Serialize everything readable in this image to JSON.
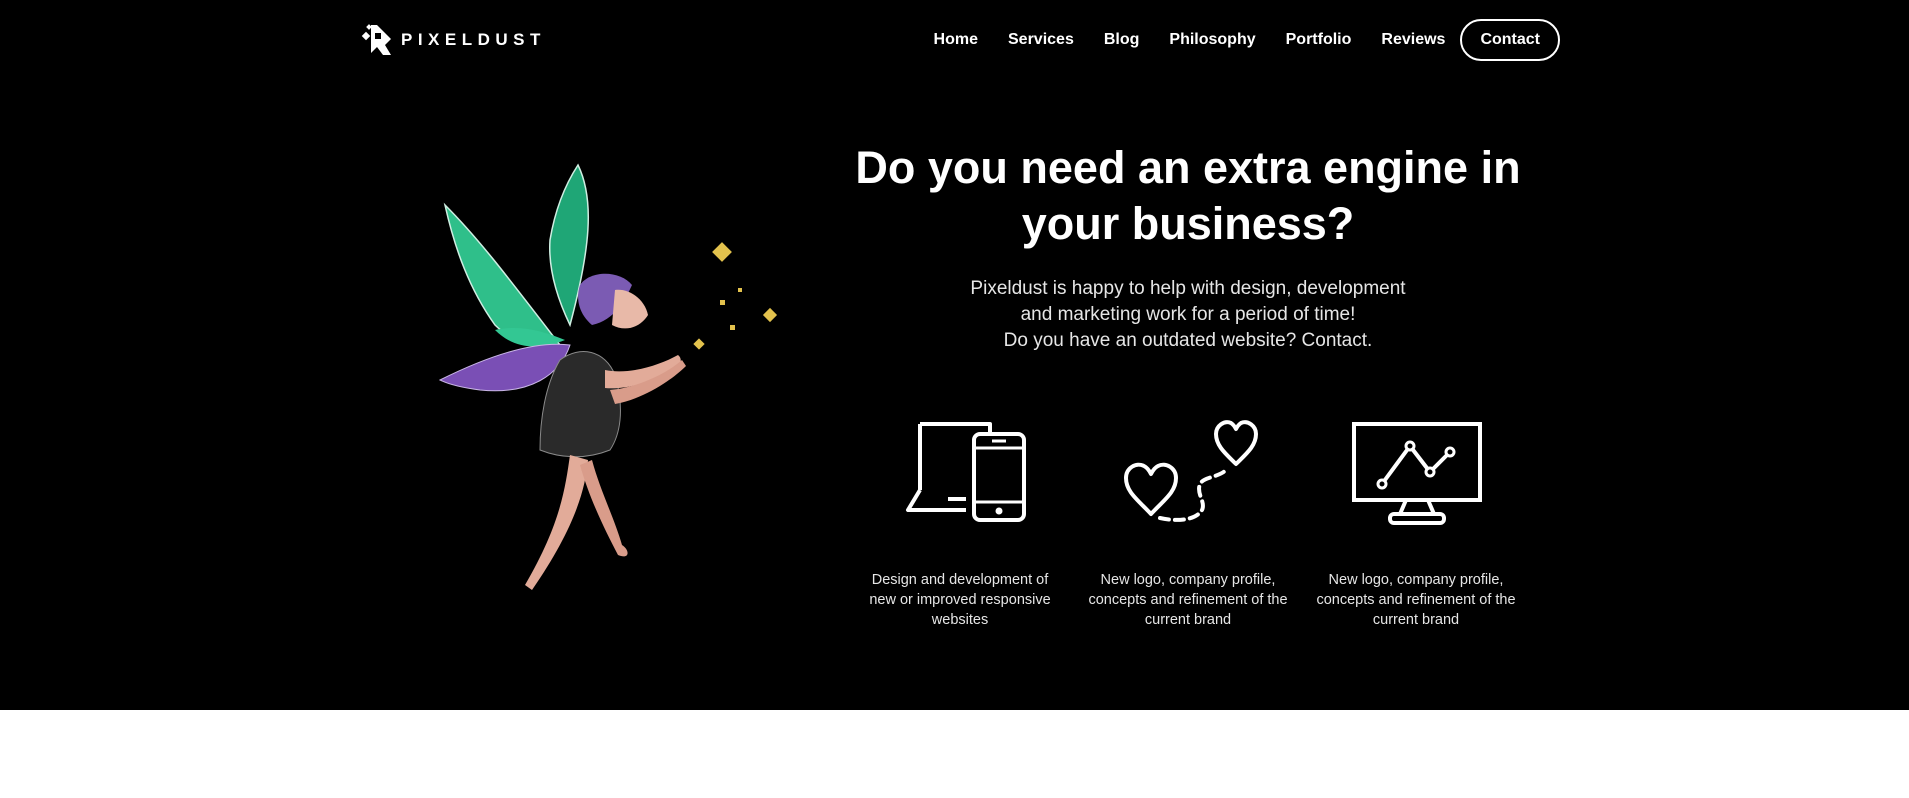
{
  "brand": {
    "name": "PIXELDUST"
  },
  "nav": {
    "links": [
      "Home",
      "Services",
      "Blog",
      "Philosophy",
      "Portfolio",
      "Reviews"
    ],
    "contact_label": "Contact"
  },
  "hero": {
    "headline": "Do you need an extra engine in your business?",
    "description_lines": [
      "Pixeldust is happy to help with design, development",
      "and marketing work for a period of time!",
      "Do you have an outdated website? Contact."
    ],
    "illustration": "fairy-illustration"
  },
  "features": [
    {
      "icon": "devices-icon",
      "text": "Design and development of new or improved responsive websites"
    },
    {
      "icon": "hearts-path-icon",
      "text": "New logo, company profile, concepts and refinement of the current brand"
    },
    {
      "icon": "monitor-chart-icon",
      "text": "New logo, company profile, concepts and refinement of the current brand"
    }
  ],
  "colors": {
    "hero_background": "#000000",
    "text": "#ffffff",
    "muted_text": "#e6e6e6",
    "page_background": "#ffffff",
    "wing_green": "#2fbf8a",
    "wing_purple": "#7a4fb5",
    "hair_purple": "#7b5bb3",
    "sparkle_gold": "#e3c24d"
  }
}
